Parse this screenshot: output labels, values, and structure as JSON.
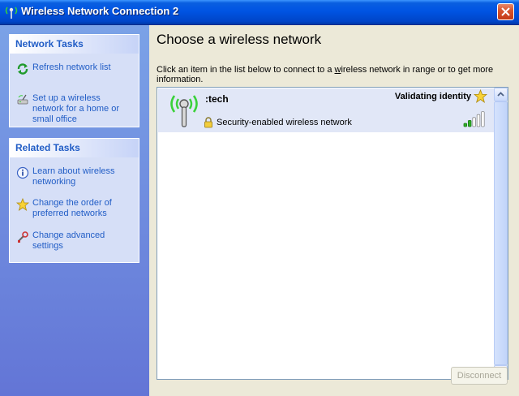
{
  "window": {
    "title": "Wireless Network Connection 2",
    "title_icon": "wireless-antenna-icon",
    "close_icon": "close-icon"
  },
  "sidebar": {
    "network_tasks": {
      "heading": "Network Tasks",
      "items": [
        {
          "label": "Refresh network list",
          "icon": "refresh-icon"
        },
        {
          "label": "Set up a wireless network for a home or small office",
          "icon": "setup-wizard-icon"
        }
      ]
    },
    "related_tasks": {
      "heading": "Related Tasks",
      "items": [
        {
          "label": "Learn about wireless networking",
          "icon": "info-icon"
        },
        {
          "label": "Change the order of preferred networks",
          "icon": "star-icon"
        },
        {
          "label": "Change advanced settings",
          "icon": "settings-icon"
        }
      ]
    }
  },
  "main": {
    "title": "Choose a wireless network",
    "instructions_pre": "Click an item in the list below to connect to a ",
    "instructions_link": "w",
    "instructions_post": "ireless network in range or to get more information.",
    "networks": [
      {
        "name": ":tech",
        "status": "Validating identity",
        "security": "Security-enabled wireless network",
        "signal_bars": 5,
        "signal_strength": 0.4
      }
    ],
    "disconnect_label": "Disconnect",
    "colors": {
      "selected_row": "#e1e7f7",
      "link": "#215dc6",
      "signal_on": "#2fb026"
    }
  }
}
